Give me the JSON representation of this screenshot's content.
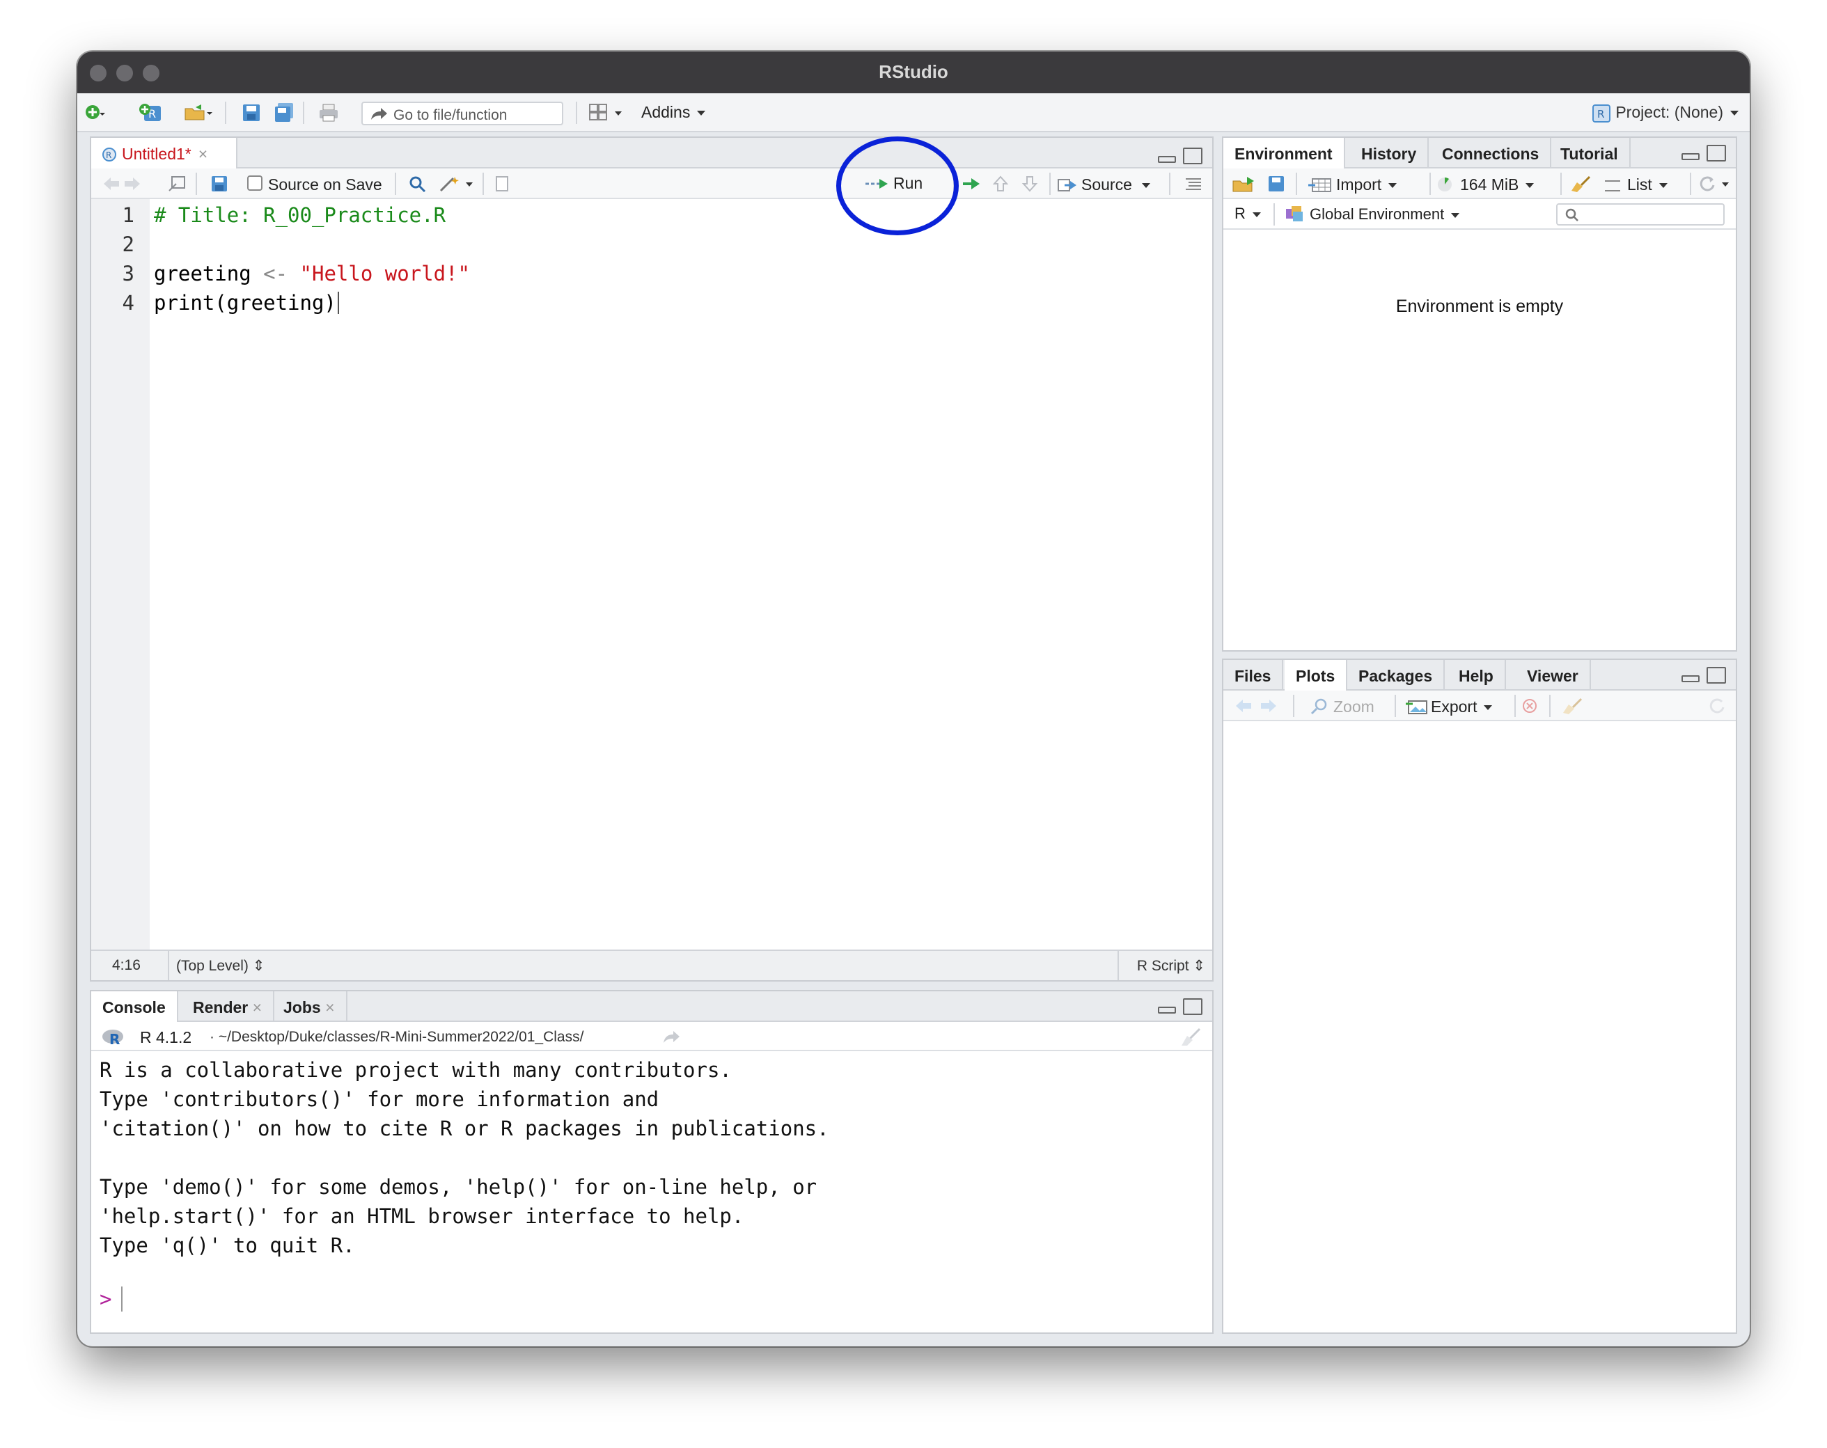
{
  "app": {
    "title": "RStudio"
  },
  "toolbar": {
    "goto_placeholder": "Go to file/function",
    "addins_label": "Addins",
    "project_label": "Project: (None)"
  },
  "editor": {
    "tab_label": "Untitled1*",
    "source_on_save_label": "Source on Save",
    "run_label": "Run",
    "source_label": "Source",
    "lines": [
      {
        "num": "1",
        "text": "# Title: R_00_Practice.R"
      },
      {
        "num": "2",
        "text": ""
      },
      {
        "num": "3",
        "parts": [
          "greeting",
          " <- ",
          "\"Hello world!\""
        ]
      },
      {
        "num": "4",
        "text": "print(greeting)"
      }
    ],
    "status_position": "4:16",
    "status_scope": "(Top Level)",
    "status_filetype": "R Script"
  },
  "env_pane": {
    "tabs": [
      "Environment",
      "History",
      "Connections",
      "Tutorial"
    ],
    "import_label": "Import",
    "memory_label": "164 MiB",
    "list_label": "List",
    "lang_label": "R",
    "scope_label": "Global Environment",
    "empty_message": "Environment is empty"
  },
  "files_pane": {
    "tabs": [
      "Files",
      "Plots",
      "Packages",
      "Help",
      "Viewer"
    ],
    "zoom_label": "Zoom",
    "export_label": "Export"
  },
  "console": {
    "tabs": [
      "Console",
      "Render",
      "Jobs"
    ],
    "r_version": "R 4.1.2",
    "path": "· ~/Desktop/Duke/classes/R-Mini-Summer2022/01_Class/",
    "output": "R is a collaborative project with many contributors.\nType 'contributors()' for more information and\n'citation()' on how to cite R or R packages in publications.\n\nType 'demo()' for some demos, 'help()' for on-line help, or\n'help.start()' for an HTML browser interface to help.\nType 'q()' to quit R.",
    "prompt": ">"
  },
  "colors": {
    "annotation_circle": "#0a22d8",
    "comment": "#1a8a1a",
    "string": "#c8161d",
    "prompt": "#b0229a"
  }
}
